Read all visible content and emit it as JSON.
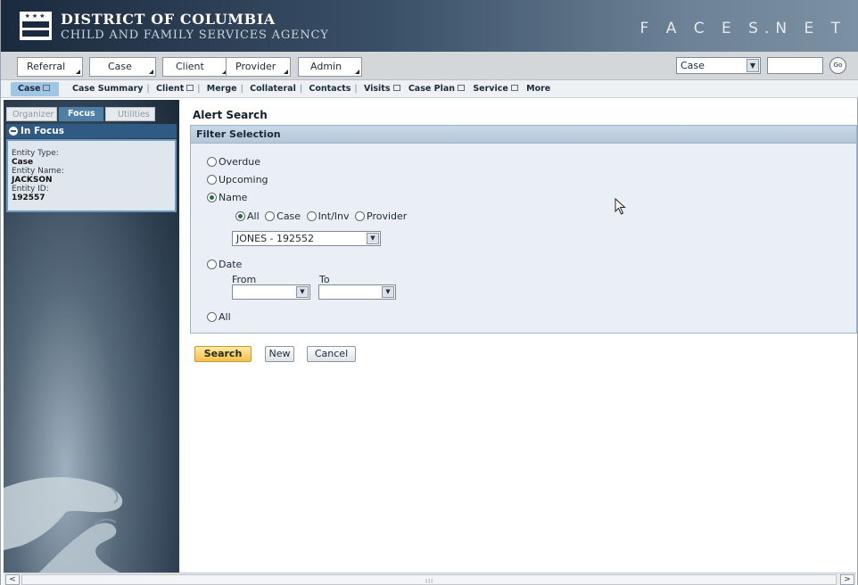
{
  "header": {
    "agency_line1": "DISTRICT OF COLUMBIA",
    "agency_line2": "CHILD AND FAMILY SERVICES AGENCY",
    "brand": "F A C E S.N E T"
  },
  "main_tabs": [
    {
      "label": "Referral"
    },
    {
      "label": "Case"
    },
    {
      "label": "Client"
    },
    {
      "label": "Provider"
    },
    {
      "label": "Admin"
    }
  ],
  "context_search": {
    "select_value": "Case",
    "input_value": "",
    "go_label": "Go"
  },
  "subnav": {
    "current": "Case",
    "items": [
      {
        "label": "Case Summary",
        "popup": false
      },
      {
        "label": "Client",
        "popup": true
      },
      {
        "label": "Merge",
        "popup": false
      },
      {
        "label": "Collateral",
        "popup": false
      },
      {
        "label": "Contacts",
        "popup": false
      },
      {
        "label": "Visits",
        "popup": true
      },
      {
        "label": "Case Plan",
        "popup": true
      },
      {
        "label": "Service",
        "popup": true
      },
      {
        "label": "More",
        "popup": false
      }
    ]
  },
  "left_panel": {
    "tabs": [
      "Organizer",
      "Focus",
      "Utilities"
    ],
    "active_tab": "Focus",
    "in_focus_title": "In Focus",
    "entity_type_label": "Entity Type:",
    "entity_type_value": "Case",
    "entity_name_label": "Entity Name:",
    "entity_name_value": "JACKSON",
    "entity_id_label": "Entity ID:",
    "entity_id_value": "192557"
  },
  "alert_search": {
    "title": "Alert Search",
    "filter_title": "Filter Selection",
    "options": {
      "overdue": "Overdue",
      "upcoming": "Upcoming",
      "name": "Name",
      "date": "Date",
      "all": "All"
    },
    "selected_option": "Name",
    "name_scope": {
      "all": "All",
      "case": "Case",
      "intinv": "Int/Inv",
      "provider": "Provider",
      "selected": "All"
    },
    "name_select_value": "JONES - 192552",
    "date_from_label": "From",
    "date_to_label": "To",
    "date_from_value": "",
    "date_to_value": ""
  },
  "buttons": {
    "search": "Search",
    "new": "New",
    "cancel": "Cancel"
  },
  "scrollbar_grip": "III"
}
